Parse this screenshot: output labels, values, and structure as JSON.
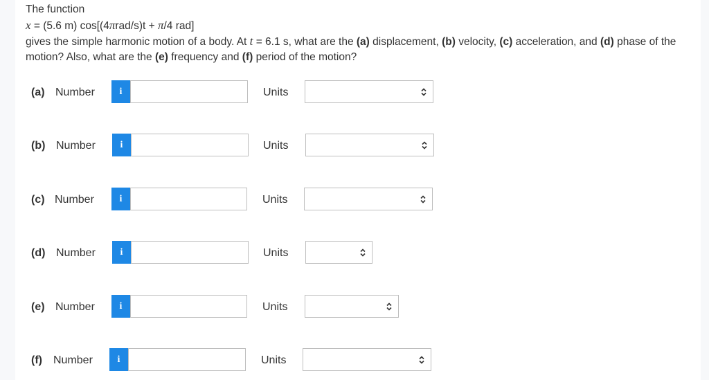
{
  "question": {
    "line1": "The function",
    "eq_var": "x",
    "eq_part1": " = (5.6 m) cos[(4",
    "eq_pi1": "π",
    "eq_part2": "rad/s)t + ",
    "eq_pi2": "π",
    "eq_part3": "/4 rad]",
    "line3_a": "gives the simple harmonic motion of a body. At ",
    "line3_t": "t",
    "line3_b": " = 6.1 s, what are the ",
    "line3_pa": "(a)",
    "line3_c": " displacement, ",
    "line3_pb": "(b)",
    "line3_d": " velocity, ",
    "line3_pc": "(c)",
    "line3_e": " acceleration, and ",
    "line3_pd": "(d)",
    "line3_f": " phase of the",
    "line4_a": "motion? Also, what are the ",
    "line4_pe": "(e)",
    "line4_b": " frequency and ",
    "line4_pf": "(f)",
    "line4_c": " period of the motion?"
  },
  "rows": [
    {
      "part": "(a)",
      "number_label": "Number",
      "info": "i",
      "value": "",
      "units_label": "Units",
      "unit_value": ""
    },
    {
      "part": "(b)",
      "number_label": "Number",
      "info": "i",
      "value": "",
      "units_label": "Units",
      "unit_value": ""
    },
    {
      "part": "(c)",
      "number_label": "Number",
      "info": "i",
      "value": "",
      "units_label": "Units",
      "unit_value": ""
    },
    {
      "part": "(d)",
      "number_label": "Number",
      "info": "i",
      "value": "",
      "units_label": "Units",
      "unit_value": ""
    },
    {
      "part": "(e)",
      "number_label": "Number",
      "info": "i",
      "value": "",
      "units_label": "Units",
      "unit_value": ""
    },
    {
      "part": "(f)",
      "number_label": "Number",
      "info": "i",
      "value": "",
      "units_label": "Units",
      "unit_value": ""
    }
  ],
  "colors": {
    "info_button": "#1e88e5",
    "border": "#bdbdbd",
    "text": "#333333"
  }
}
